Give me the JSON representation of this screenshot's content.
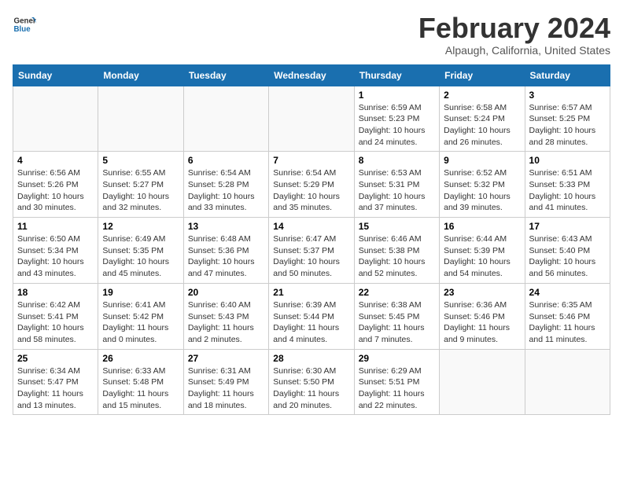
{
  "logo": {
    "line1": "General",
    "line2": "Blue"
  },
  "title": "February 2024",
  "subtitle": "Alpaugh, California, United States",
  "days_of_week": [
    "Sunday",
    "Monday",
    "Tuesday",
    "Wednesday",
    "Thursday",
    "Friday",
    "Saturday"
  ],
  "weeks": [
    [
      {
        "day": "",
        "info": ""
      },
      {
        "day": "",
        "info": ""
      },
      {
        "day": "",
        "info": ""
      },
      {
        "day": "",
        "info": ""
      },
      {
        "day": "1",
        "info": "Sunrise: 6:59 AM\nSunset: 5:23 PM\nDaylight: 10 hours\nand 24 minutes."
      },
      {
        "day": "2",
        "info": "Sunrise: 6:58 AM\nSunset: 5:24 PM\nDaylight: 10 hours\nand 26 minutes."
      },
      {
        "day": "3",
        "info": "Sunrise: 6:57 AM\nSunset: 5:25 PM\nDaylight: 10 hours\nand 28 minutes."
      }
    ],
    [
      {
        "day": "4",
        "info": "Sunrise: 6:56 AM\nSunset: 5:26 PM\nDaylight: 10 hours\nand 30 minutes."
      },
      {
        "day": "5",
        "info": "Sunrise: 6:55 AM\nSunset: 5:27 PM\nDaylight: 10 hours\nand 32 minutes."
      },
      {
        "day": "6",
        "info": "Sunrise: 6:54 AM\nSunset: 5:28 PM\nDaylight: 10 hours\nand 33 minutes."
      },
      {
        "day": "7",
        "info": "Sunrise: 6:54 AM\nSunset: 5:29 PM\nDaylight: 10 hours\nand 35 minutes."
      },
      {
        "day": "8",
        "info": "Sunrise: 6:53 AM\nSunset: 5:31 PM\nDaylight: 10 hours\nand 37 minutes."
      },
      {
        "day": "9",
        "info": "Sunrise: 6:52 AM\nSunset: 5:32 PM\nDaylight: 10 hours\nand 39 minutes."
      },
      {
        "day": "10",
        "info": "Sunrise: 6:51 AM\nSunset: 5:33 PM\nDaylight: 10 hours\nand 41 minutes."
      }
    ],
    [
      {
        "day": "11",
        "info": "Sunrise: 6:50 AM\nSunset: 5:34 PM\nDaylight: 10 hours\nand 43 minutes."
      },
      {
        "day": "12",
        "info": "Sunrise: 6:49 AM\nSunset: 5:35 PM\nDaylight: 10 hours\nand 45 minutes."
      },
      {
        "day": "13",
        "info": "Sunrise: 6:48 AM\nSunset: 5:36 PM\nDaylight: 10 hours\nand 47 minutes."
      },
      {
        "day": "14",
        "info": "Sunrise: 6:47 AM\nSunset: 5:37 PM\nDaylight: 10 hours\nand 50 minutes."
      },
      {
        "day": "15",
        "info": "Sunrise: 6:46 AM\nSunset: 5:38 PM\nDaylight: 10 hours\nand 52 minutes."
      },
      {
        "day": "16",
        "info": "Sunrise: 6:44 AM\nSunset: 5:39 PM\nDaylight: 10 hours\nand 54 minutes."
      },
      {
        "day": "17",
        "info": "Sunrise: 6:43 AM\nSunset: 5:40 PM\nDaylight: 10 hours\nand 56 minutes."
      }
    ],
    [
      {
        "day": "18",
        "info": "Sunrise: 6:42 AM\nSunset: 5:41 PM\nDaylight: 10 hours\nand 58 minutes."
      },
      {
        "day": "19",
        "info": "Sunrise: 6:41 AM\nSunset: 5:42 PM\nDaylight: 11 hours\nand 0 minutes."
      },
      {
        "day": "20",
        "info": "Sunrise: 6:40 AM\nSunset: 5:43 PM\nDaylight: 11 hours\nand 2 minutes."
      },
      {
        "day": "21",
        "info": "Sunrise: 6:39 AM\nSunset: 5:44 PM\nDaylight: 11 hours\nand 4 minutes."
      },
      {
        "day": "22",
        "info": "Sunrise: 6:38 AM\nSunset: 5:45 PM\nDaylight: 11 hours\nand 7 minutes."
      },
      {
        "day": "23",
        "info": "Sunrise: 6:36 AM\nSunset: 5:46 PM\nDaylight: 11 hours\nand 9 minutes."
      },
      {
        "day": "24",
        "info": "Sunrise: 6:35 AM\nSunset: 5:46 PM\nDaylight: 11 hours\nand 11 minutes."
      }
    ],
    [
      {
        "day": "25",
        "info": "Sunrise: 6:34 AM\nSunset: 5:47 PM\nDaylight: 11 hours\nand 13 minutes."
      },
      {
        "day": "26",
        "info": "Sunrise: 6:33 AM\nSunset: 5:48 PM\nDaylight: 11 hours\nand 15 minutes."
      },
      {
        "day": "27",
        "info": "Sunrise: 6:31 AM\nSunset: 5:49 PM\nDaylight: 11 hours\nand 18 minutes."
      },
      {
        "day": "28",
        "info": "Sunrise: 6:30 AM\nSunset: 5:50 PM\nDaylight: 11 hours\nand 20 minutes."
      },
      {
        "day": "29",
        "info": "Sunrise: 6:29 AM\nSunset: 5:51 PM\nDaylight: 11 hours\nand 22 minutes."
      },
      {
        "day": "",
        "info": ""
      },
      {
        "day": "",
        "info": ""
      }
    ]
  ]
}
